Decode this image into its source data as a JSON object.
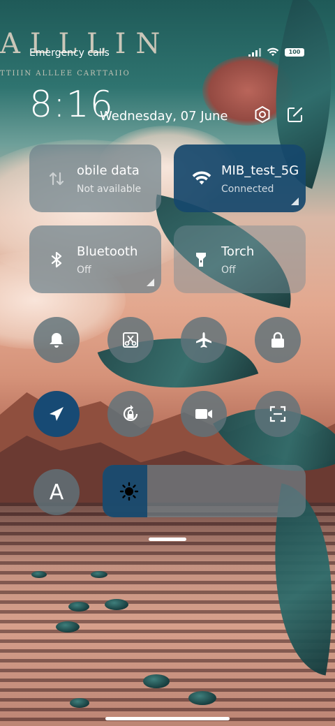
{
  "wallpaper": {
    "brand_text": "ALLLIN",
    "brand_subtext": "TTIIIN ALLLEE CARTTAIIO"
  },
  "status_bar": {
    "carrier_text": "Emergency calls",
    "battery_level": "100",
    "icons": [
      "signal-icon",
      "wifi-icon",
      "battery-icon"
    ]
  },
  "header": {
    "time": "8:16",
    "date": "Wednesday, 07 June",
    "icons": [
      "settings-icon",
      "edit-icon"
    ]
  },
  "tiles": [
    {
      "name": "obile data",
      "status": "Not available",
      "icon": "mobile-data-icon",
      "active": false
    },
    {
      "name": "MIB_test_5G",
      "status": "Connected",
      "icon": "wifi-icon",
      "active": true
    },
    {
      "name": "Bluetooth",
      "status": "Off",
      "icon": "bluetooth-icon",
      "active": false
    },
    {
      "name": "Torch",
      "status": "Off",
      "icon": "torch-icon",
      "active": false
    }
  ],
  "toggles": [
    {
      "icon": "bell-icon",
      "active": false
    },
    {
      "icon": "screenshot-icon",
      "active": false
    },
    {
      "icon": "airplane-icon",
      "active": false
    },
    {
      "icon": "lock-icon",
      "active": false
    },
    {
      "icon": "location-icon",
      "active": true
    },
    {
      "icon": "rotation-lock-icon",
      "active": false
    },
    {
      "icon": "video-camera-icon",
      "active": false
    },
    {
      "icon": "scan-icon",
      "active": false
    },
    {
      "icon": "auto-brightness-icon",
      "active": false,
      "label": "A"
    }
  ],
  "brightness": {
    "level": 0.22,
    "icon": "sun-icon"
  },
  "colors": {
    "active_blue": "#174a74",
    "tile_grey": "#6e828c"
  }
}
